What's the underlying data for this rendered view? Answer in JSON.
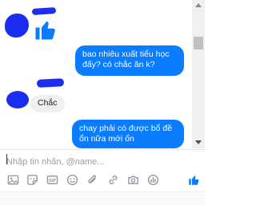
{
  "chat": {
    "messages": [
      {
        "side": "outgoing",
        "text": "bao nhiêu xuất tiểu học đấy? có chắc ăn k?"
      },
      {
        "side": "incoming",
        "text": "Chắc"
      },
      {
        "side": "outgoing",
        "text": "chay phải có được bổ đề ổn nữa mới ổn"
      }
    ]
  },
  "composer": {
    "placeholder": "Nhập tin nhắn, @name..."
  },
  "colors": {
    "outgoing_bubble": "#0a7cff",
    "incoming_bubble": "#f1f0f0",
    "icon_gray": "#8d949e",
    "accent": "#0a7cff",
    "redaction": "#1b2ef0"
  },
  "toolbar": {
    "icons": [
      "image-icon",
      "sticker-icon",
      "gif-icon",
      "emoji-icon",
      "attachment-icon",
      "link-icon",
      "camera-icon",
      "poll-icon",
      "like-icon"
    ],
    "gif_label": "GIF"
  }
}
